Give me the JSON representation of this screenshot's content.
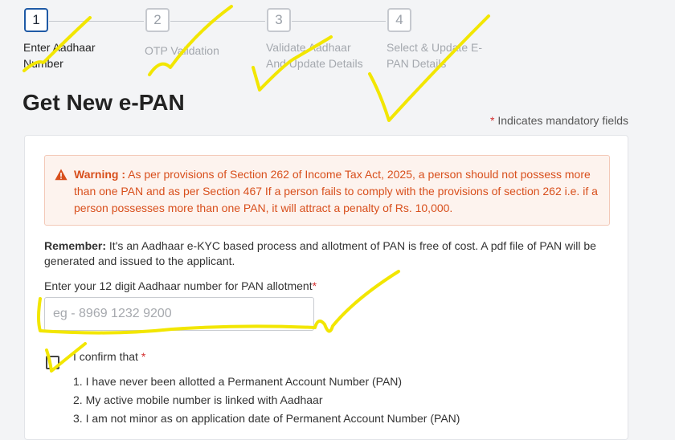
{
  "stepper": {
    "steps": [
      {
        "number": "1",
        "label": "Enter Aadhaar Number",
        "active": true
      },
      {
        "number": "2",
        "label": "OTP Validation",
        "active": false
      },
      {
        "number": "3",
        "label": "Validate Aadhaar And Update Details",
        "active": false
      },
      {
        "number": "4",
        "label": "Select & Update E-PAN Details",
        "active": false
      }
    ]
  },
  "page": {
    "title": "Get New e-PAN",
    "mandatory_star": "*",
    "mandatory_note": " Indicates mandatory fields"
  },
  "warning": {
    "title": "Warning :",
    "text": " As per provisions of Section 262 of Income Tax Act, 2025, a person should not possess more than one PAN and as per Section 467 If a person fails to comply with the provisions of section 262 i.e. if a person possesses more than one PAN, it will attract a penalty of Rs. 10,000."
  },
  "remember": {
    "label": "Remember:",
    "text": " It's an Aadhaar e-KYC based process and allotment of PAN is free of cost. A pdf file of PAN will be generated and issued to the applicant."
  },
  "aadhaar": {
    "label": "Enter your 12 digit Aadhaar number for PAN allotment",
    "required_star": "*",
    "placeholder": "eg - 8969 1232 9200",
    "value": ""
  },
  "confirm": {
    "label": "I confirm that ",
    "required_star": "*",
    "checked": false,
    "items": [
      "1. I have never been allotted a Permanent Account Number (PAN)",
      "2. My active mobile number is linked with Aadhaar",
      "3. I am not minor as on application date of Permanent Account Number (PAN)"
    ]
  },
  "colors": {
    "primary": "#1f5aa6",
    "warning_text": "#d84f1c",
    "warning_bg": "#fdf3ee",
    "required": "#d32f2f",
    "annotation": "#f2e600"
  }
}
